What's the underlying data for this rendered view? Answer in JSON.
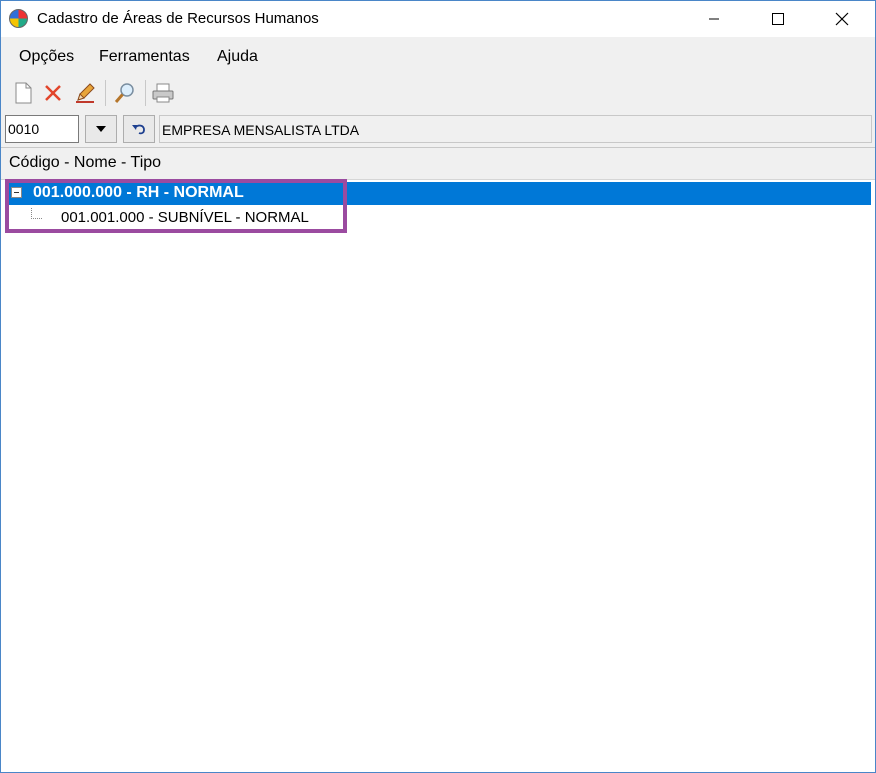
{
  "window": {
    "title": "Cadastro de Áreas de Recursos Humanos"
  },
  "menu": {
    "items": [
      "Opções",
      "Ferramentas",
      "Ajuda"
    ]
  },
  "toolbar": {
    "icons": [
      "new-document-icon",
      "delete-icon",
      "edit-pencil-icon",
      "search-magnifier-icon",
      "print-icon"
    ]
  },
  "company": {
    "code": "0010",
    "name": "EMPRESA MENSALISTA LTDA"
  },
  "tree": {
    "header": "Código - Nome - Tipo",
    "nodes": [
      {
        "label": "001.000.000 - RH - NORMAL",
        "selected": true,
        "expanded": true
      },
      {
        "label": "001.001.000 - SUBNÍVEL - NORMAL",
        "selected": false
      }
    ]
  },
  "colors": {
    "selection": "#0078d7",
    "highlight": "#9b4ba0"
  }
}
